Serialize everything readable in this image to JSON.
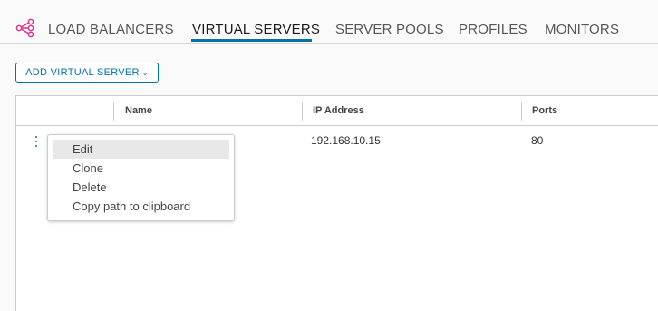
{
  "tabs": [
    {
      "label": "LOAD BALANCERS",
      "active": false
    },
    {
      "label": "VIRTUAL SERVERS",
      "active": true
    },
    {
      "label": "SERVER POOLS",
      "active": false
    },
    {
      "label": "PROFILES",
      "active": false
    },
    {
      "label": "MONITORS",
      "active": false
    }
  ],
  "icons": {
    "load_balancer": "load-balancer-share-icon",
    "kebab": "vertical-ellipsis-icon",
    "chevron": "chevron-down-icon"
  },
  "colors": {
    "accent": "#0072a3",
    "lb_icon": "#d9388a"
  },
  "toolbar": {
    "add_label": "ADD VIRTUAL SERVER",
    "add_chevron": "⌄"
  },
  "grid": {
    "columns": [
      "Name",
      "IP Address",
      "Ports"
    ],
    "rows": [
      {
        "name": "",
        "ip": "192.168.10.15",
        "ports": "80"
      }
    ]
  },
  "context_menu": {
    "items": [
      "Edit",
      "Clone",
      "Delete",
      "Copy path to clipboard"
    ],
    "hovered_index": 0
  }
}
